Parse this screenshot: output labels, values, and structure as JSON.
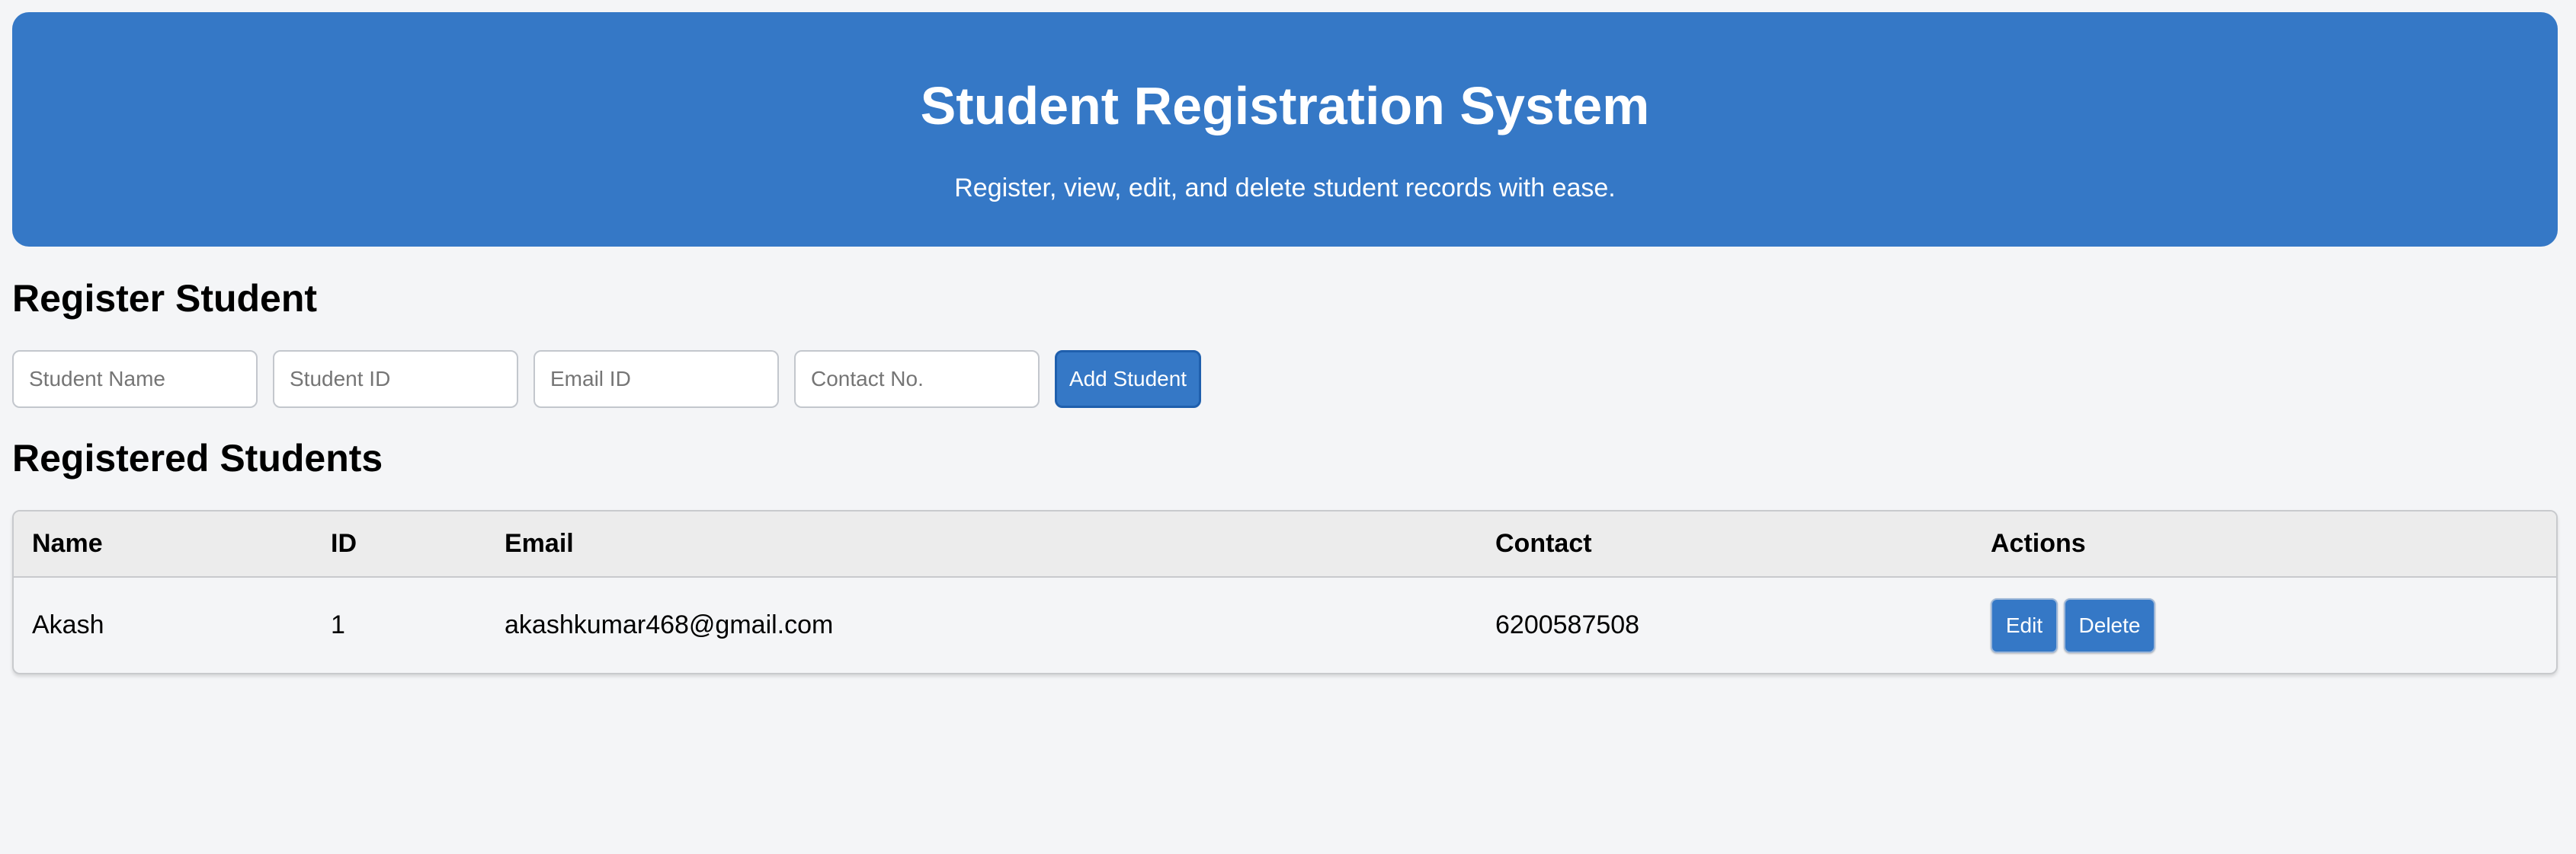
{
  "header": {
    "title": "Student Registration System",
    "subtitle": "Register, view, edit, and delete student records with ease."
  },
  "register_section": {
    "title": "Register Student",
    "fields": {
      "name_placeholder": "Student Name",
      "id_placeholder": "Student ID",
      "email_placeholder": "Email ID",
      "contact_placeholder": "Contact No."
    },
    "add_button_label": "Add Student"
  },
  "registered_section": {
    "title": "Registered Students",
    "columns": {
      "name": "Name",
      "id": "ID",
      "email": "Email",
      "contact": "Contact",
      "actions": "Actions"
    },
    "rows": [
      {
        "name": "Akash",
        "id": "1",
        "email": "akashkumar468@gmail.com",
        "contact": "6200587508",
        "edit_label": "Edit",
        "delete_label": "Delete"
      }
    ]
  },
  "colors": {
    "primary": "#3578c6",
    "background": "#f4f5f7",
    "table_header": "#ececec"
  }
}
